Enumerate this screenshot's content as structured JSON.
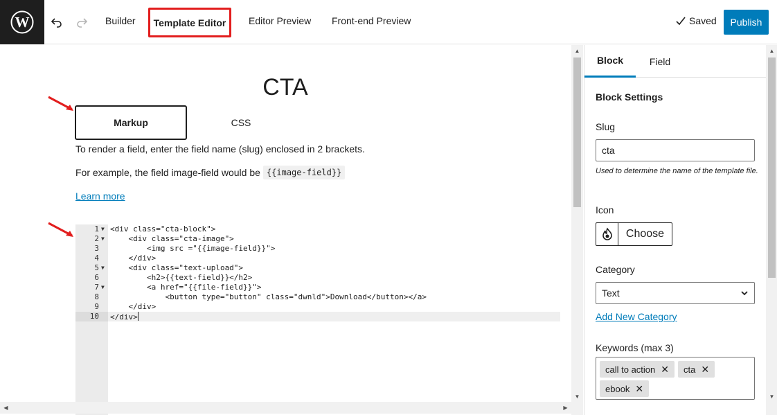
{
  "topbar": {
    "nav": {
      "builder": "Builder",
      "template_editor": "Template Editor",
      "editor_preview": "Editor Preview",
      "frontend_preview": "Front-end Preview"
    },
    "saved_label": "Saved",
    "publish_label": "Publish",
    "highlight_color": "#e21e1e",
    "accent_color": "#007cba"
  },
  "editor": {
    "title": "CTA",
    "tabs": {
      "markup": "Markup",
      "css": "CSS"
    },
    "help_line_1": "To render a field, enter the field name (slug) enclosed in 2 brackets.",
    "help_line_2_prefix": "For example, the field image-field would be",
    "help_line_2_code": "{{image-field}}",
    "learn_more": "Learn more",
    "code_lines": [
      {
        "n": "1",
        "text": "<div class=\"cta-block\">"
      },
      {
        "n": "2",
        "text": "    <div class=\"cta-image\">"
      },
      {
        "n": "3",
        "text": "        <img src =\"{{image-field}}\">"
      },
      {
        "n": "4",
        "text": "    </div>"
      },
      {
        "n": "5",
        "text": "    <div class=\"text-upload\">"
      },
      {
        "n": "6",
        "text": "        <h2>{{text-field}}</h2>"
      },
      {
        "n": "7",
        "text": "        <a href=\"{{file-field}}\">"
      },
      {
        "n": "8",
        "text": "            <button type=\"button\" class=\"dwnld\">Download</button></a>"
      },
      {
        "n": "9",
        "text": "    </div>"
      },
      {
        "n": "10",
        "text": "</div>"
      }
    ]
  },
  "sidebar": {
    "tabs": {
      "block": "Block",
      "field": "Field"
    },
    "section_title": "Block Settings",
    "slug_label": "Slug",
    "slug_value": "cta",
    "slug_help": "Used to determine the name of the template file.",
    "icon_label": "Icon",
    "icon_choose": "Choose",
    "category_label": "Category",
    "category_value": "Text",
    "add_category": "Add New Category",
    "keywords_label": "Keywords (max 3)",
    "keywords": [
      "call to action",
      "cta",
      "ebook"
    ]
  }
}
